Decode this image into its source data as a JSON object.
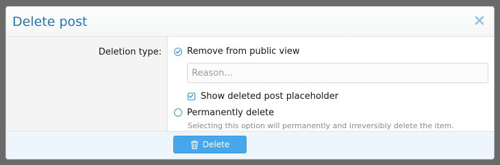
{
  "dialog": {
    "title": "Delete post",
    "close_icon": "close-icon"
  },
  "form": {
    "field_label": "Deletion type:",
    "options": [
      {
        "label": "Remove from public view",
        "selected": true
      },
      {
        "label": "Permanently delete",
        "selected": false
      }
    ],
    "reason": {
      "value": "",
      "placeholder": "Reason..."
    },
    "placeholder_checkbox": {
      "label": "Show deleted post placeholder",
      "checked": true
    },
    "permanent_hint": "Selecting this option will permanently and irreversibly delete the item."
  },
  "footer": {
    "delete_label": "Delete",
    "delete_icon": "trash-icon"
  },
  "colors": {
    "accent": "#2577b1",
    "button": "#47a7eb",
    "footer_bg": "#edf6fc"
  }
}
